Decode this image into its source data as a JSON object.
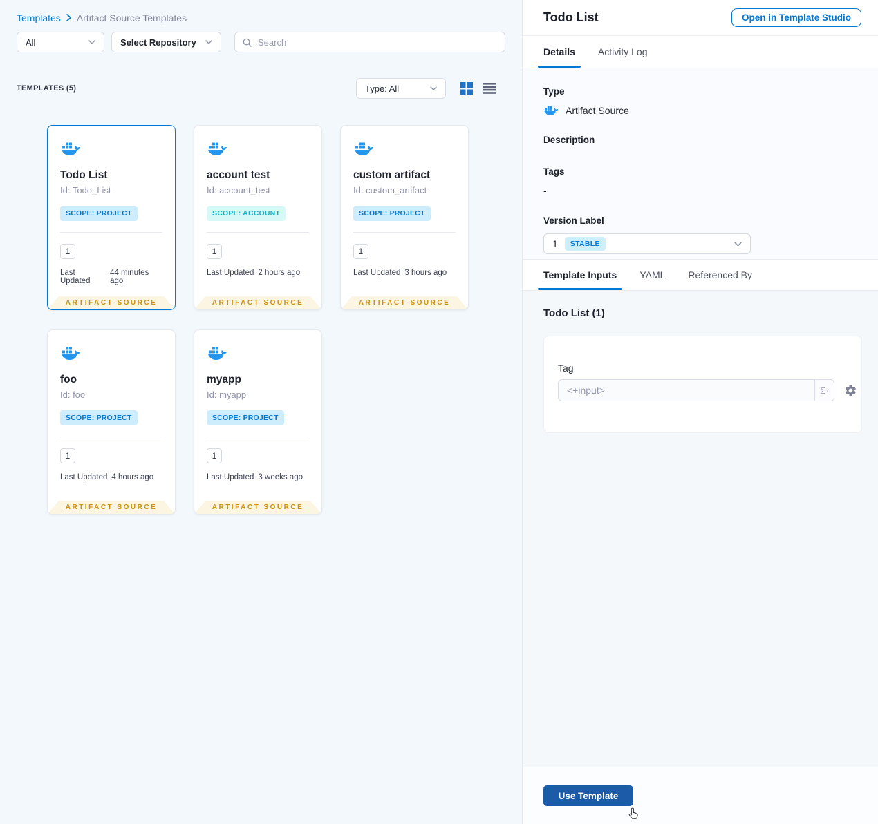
{
  "colors": {
    "accent": "#0278d5",
    "primary_btn": "#1b5ba8",
    "docker_blue": "#2496ed",
    "badge_project_bg": "#cdecfc",
    "badge_project_text": "#0278d5",
    "badge_account_bg": "#d6f9f7",
    "badge_account_text": "#0ab5c9",
    "stable_bg": "#cdeefb",
    "stable_text": "#0278d5",
    "ribbon_bg": "#fcf5e1",
    "ribbon_text": "#c9920f"
  },
  "left": {
    "breadcrumb": {
      "root": "Templates",
      "current": "Artifact Source Templates"
    },
    "filters": {
      "scope_value": "All",
      "repository_placeholder": "Select Repository",
      "search_placeholder": "Search"
    },
    "list_title": "TEMPLATES (5)",
    "type_filter_value": "Type: All",
    "cards": [
      {
        "name": "Todo List",
        "id": "Id: Todo_List",
        "scope": "SCOPE: PROJECT",
        "version_count": "1",
        "updated_label": "Last Updated",
        "updated_value": "44 minutes ago",
        "ribbon": "ARTIFACT SOURCE"
      },
      {
        "name": "account test",
        "id": "Id: account_test",
        "scope": "SCOPE: ACCOUNT",
        "version_count": "1",
        "updated_label": "Last Updated",
        "updated_value": "2 hours ago",
        "ribbon": "ARTIFACT SOURCE"
      },
      {
        "name": "custom artifact",
        "id": "Id: custom_artifact",
        "scope": "SCOPE: PROJECT",
        "version_count": "1",
        "updated_label": "Last Updated",
        "updated_value": "3 hours ago",
        "ribbon": "ARTIFACT SOURCE"
      },
      {
        "name": "foo",
        "id": "Id: foo",
        "scope": "SCOPE: PROJECT",
        "version_count": "1",
        "updated_label": "Last Updated",
        "updated_value": "4 hours ago",
        "ribbon": "ARTIFACT SOURCE"
      },
      {
        "name": "myapp",
        "id": "Id: myapp",
        "scope": "SCOPE: PROJECT",
        "version_count": "1",
        "updated_label": "Last Updated",
        "updated_value": "3 weeks ago",
        "ribbon": "ARTIFACT SOURCE"
      }
    ]
  },
  "panel": {
    "title": "Todo List",
    "open_button": "Open in Template Studio",
    "tabs": {
      "details": "Details",
      "activity_log": "Activity Log"
    },
    "details": {
      "type_label": "Type",
      "type_value": "Artifact Source",
      "description_label": "Description",
      "tags_label": "Tags",
      "tags_value": "-",
      "version_label": "Version Label",
      "version_value": "1",
      "version_badge": "STABLE"
    },
    "sub_tabs": {
      "inputs": "Template Inputs",
      "yaml": "YAML",
      "referenced_by": "Referenced By"
    },
    "inputs": {
      "section_title": "Todo List (1)",
      "field_label": "Tag",
      "field_value": "<+input>",
      "runtime_symbol": "Σ",
      "runtime_sup": "x"
    },
    "use_button": "Use Template"
  }
}
